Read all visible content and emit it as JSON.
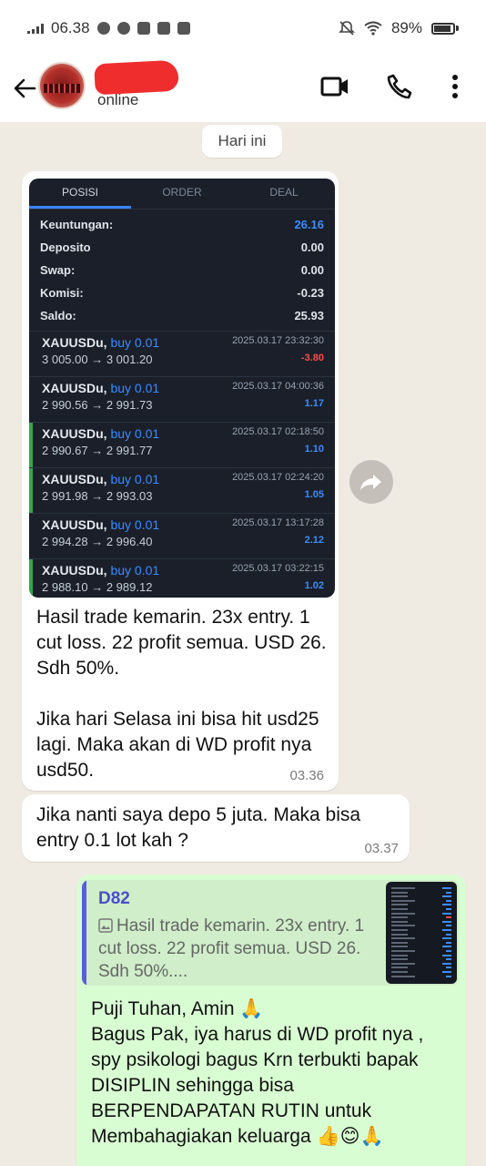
{
  "status_bar": {
    "time": "06.38",
    "battery": "89%",
    "battery_level": 0.89
  },
  "header": {
    "contact_status": "online"
  },
  "date_chip": "Hari ini",
  "trade_screenshot": {
    "tabs": [
      "POSISI",
      "ORDER",
      "DEAL"
    ],
    "active_tab": "POSISI",
    "summary": [
      {
        "label": "Keuntungan:",
        "value": "26.16",
        "highlight": true
      },
      {
        "label": "Deposito",
        "value": "0.00"
      },
      {
        "label": "Swap:",
        "value": "0.00"
      },
      {
        "label": "Komisi:",
        "value": "-0.23"
      },
      {
        "label": "Saldo:",
        "value": "25.93"
      }
    ],
    "deals": [
      {
        "symbol": "XAUUSDu,",
        "type": "buy 0.01",
        "datetime": "2025.03.17 23:32:30",
        "prices": "3 005.00 → 3 001.20",
        "profit": "-3.80",
        "negative": true,
        "bar": false
      },
      {
        "symbol": "XAUUSDu,",
        "type": "buy 0.01",
        "datetime": "2025.03.17 04:00:36",
        "prices": "2 990.56 → 2 991.73",
        "profit": "1.17",
        "negative": false,
        "bar": false
      },
      {
        "symbol": "XAUUSDu,",
        "type": "buy 0.01",
        "datetime": "2025.03.17 02:18:50",
        "prices": "2 990.67 → 2 991.77",
        "profit": "1.10",
        "negative": false,
        "bar": true
      },
      {
        "symbol": "XAUUSDu,",
        "type": "buy 0.01",
        "datetime": "2025.03.17 02:24:20",
        "prices": "2 991.98 → 2 993.03",
        "profit": "1.05",
        "negative": false,
        "bar": true
      },
      {
        "symbol": "XAUUSDu,",
        "type": "buy 0.01",
        "datetime": "2025.03.17 13:17:28",
        "prices": "2 994.28 → 2 996.40",
        "profit": "2.12",
        "negative": false,
        "bar": false
      },
      {
        "symbol": "XAUUSDu,",
        "type": "buy 0.01",
        "datetime": "2025.03.17 03:22:15",
        "prices": "2 988.10 → 2 989.12",
        "profit": "1.02",
        "negative": false,
        "bar": true
      }
    ]
  },
  "messages": {
    "msg1_text": "Hasil trade kemarin. 23x entry. 1 cut loss. 22 profit semua. USD 26. Sdh 50%.\n\nJika hari Selasa ini bisa hit usd25 lagi. Maka akan di WD profit nya usd50.",
    "msg1_time": "03.36",
    "msg2_text": "Jika nanti saya depo 5 juta. Maka bisa entry 0.1 lot kah ?",
    "msg2_time": "03.37",
    "reply_quote_name": "D82",
    "reply_quote_text": "Hasil trade kemarin. 23x entry. 1 cut loss. 22 profit semua. USD 26. Sdh 50%....",
    "reply_text": "Puji Tuhan, Amin 🙏\nBagus Pak, iya harus di WD profit nya , spy psikologi bagus Krn terbukti bapak DISIPLIN sehingga bisa BERPENDAPATAN RUTIN untuk Membahagiakan keluarga 👍😊🙏"
  },
  "colors": {
    "chat_bg": "#efeae2",
    "outgoing_bubble": "#d9fdd3",
    "incoming_bubble": "#ffffff",
    "redaction": "#ef2d2d",
    "profit_blue": "#3b8cff",
    "loss_red": "#ff4a4a"
  }
}
